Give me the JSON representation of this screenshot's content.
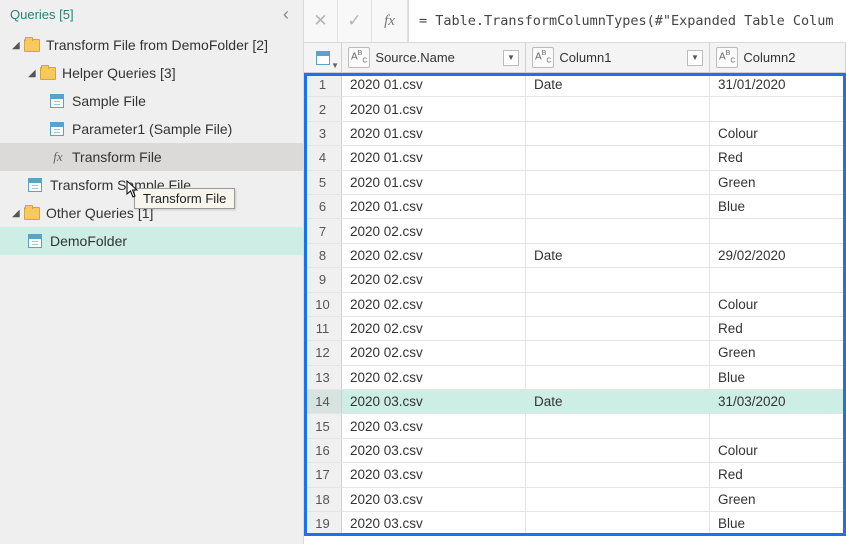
{
  "queries_header": "Queries [5]",
  "tree": {
    "group1": {
      "label": "Transform File from DemoFolder [2]"
    },
    "group1a": {
      "label": "Helper Queries [3]"
    },
    "sample_file": "Sample File",
    "parameter1": "Parameter1 (Sample File)",
    "transform_file": "Transform File",
    "transform_sample_file": "Transform Sample File",
    "group2": {
      "label": "Other Queries [1]"
    },
    "demo_folder": "DemoFolder"
  },
  "tooltip": "Transform File",
  "formula": "= Table.TransformColumnTypes(#\"Expanded Table Colum",
  "columns": {
    "c1": "Source.Name",
    "c2": "Column1",
    "c3": "Column2"
  },
  "rows": [
    {
      "n": "1",
      "c1": "2020 01.csv",
      "c2": "Date",
      "c3": "31/01/2020",
      "hl": false
    },
    {
      "n": "2",
      "c1": "2020 01.csv",
      "c2": "",
      "c3": "",
      "hl": false
    },
    {
      "n": "3",
      "c1": "2020 01.csv",
      "c2": "",
      "c3": "Colour",
      "hl": false
    },
    {
      "n": "4",
      "c1": "2020 01.csv",
      "c2": "",
      "c3": "Red",
      "hl": false
    },
    {
      "n": "5",
      "c1": "2020 01.csv",
      "c2": "",
      "c3": "Green",
      "hl": false
    },
    {
      "n": "6",
      "c1": "2020 01.csv",
      "c2": "",
      "c3": "Blue",
      "hl": false
    },
    {
      "n": "7",
      "c1": "2020 02.csv",
      "c2": "",
      "c3": "",
      "hl": false
    },
    {
      "n": "8",
      "c1": "2020 02.csv",
      "c2": "Date",
      "c3": "29/02/2020",
      "hl": false
    },
    {
      "n": "9",
      "c1": "2020 02.csv",
      "c2": "",
      "c3": "",
      "hl": false
    },
    {
      "n": "10",
      "c1": "2020 02.csv",
      "c2": "",
      "c3": "Colour",
      "hl": false
    },
    {
      "n": "11",
      "c1": "2020 02.csv",
      "c2": "",
      "c3": "Red",
      "hl": false
    },
    {
      "n": "12",
      "c1": "2020 02.csv",
      "c2": "",
      "c3": "Green",
      "hl": false
    },
    {
      "n": "13",
      "c1": "2020 02.csv",
      "c2": "",
      "c3": "Blue",
      "hl": false
    },
    {
      "n": "14",
      "c1": "2020 03.csv",
      "c2": "Date",
      "c3": "31/03/2020",
      "hl": true
    },
    {
      "n": "15",
      "c1": "2020 03.csv",
      "c2": "",
      "c3": "",
      "hl": false
    },
    {
      "n": "16",
      "c1": "2020 03.csv",
      "c2": "",
      "c3": "Colour",
      "hl": false
    },
    {
      "n": "17",
      "c1": "2020 03.csv",
      "c2": "",
      "c3": "Red",
      "hl": false
    },
    {
      "n": "18",
      "c1": "2020 03.csv",
      "c2": "",
      "c3": "Green",
      "hl": false
    },
    {
      "n": "19",
      "c1": "2020 03.csv",
      "c2": "",
      "c3": "Blue",
      "hl": false
    }
  ]
}
